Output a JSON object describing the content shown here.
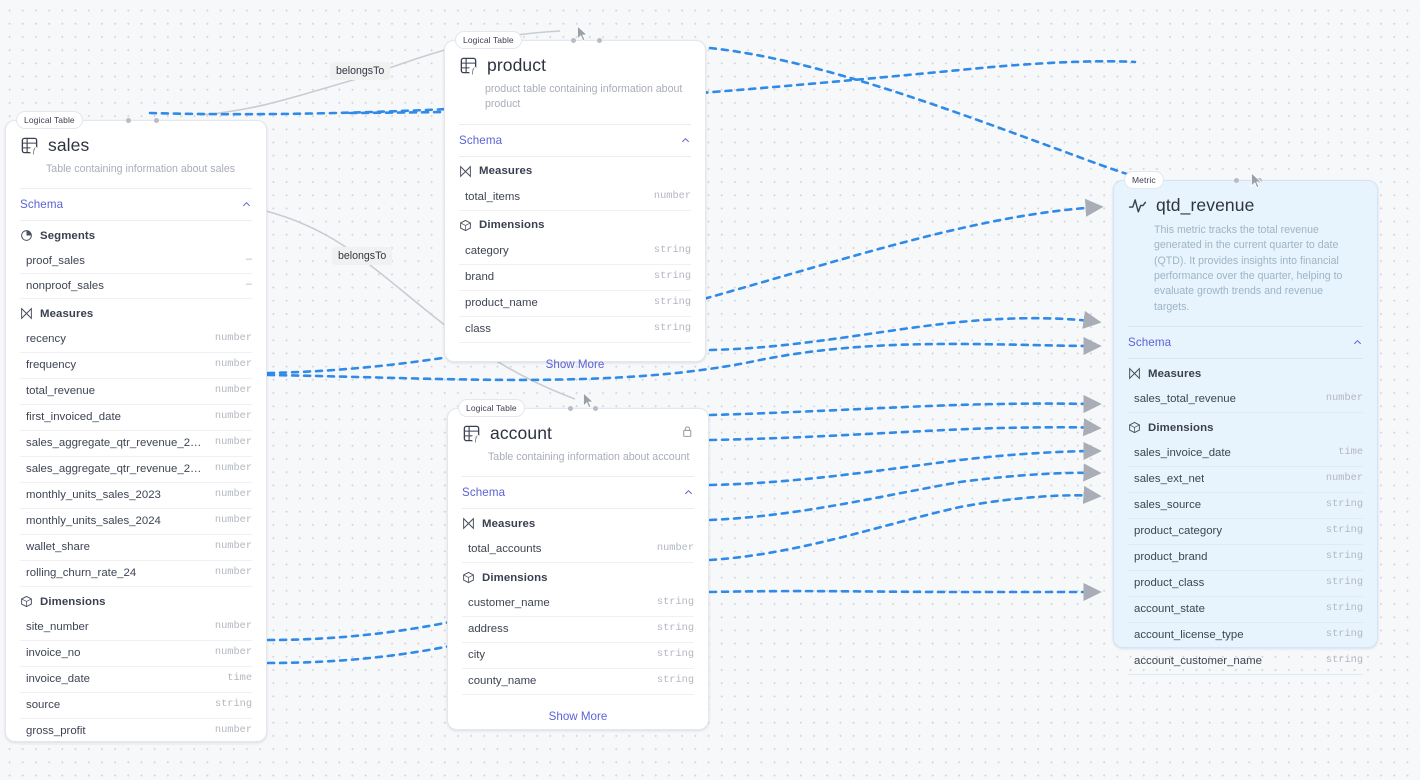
{
  "canvas": {
    "background_color": "#f7f8fa",
    "grid_dot_color": "#d2d6dd",
    "edge_color_primary": "#2f8ae8",
    "edge_color_secondary": "#c9ccd2",
    "accent_color": "#5b62d6",
    "metric_card_color": "#e8f4fd"
  },
  "edge_labels": [
    {
      "text": "belongsTo"
    },
    {
      "text": "belongsTo"
    }
  ],
  "nodes": {
    "sales": {
      "badge": "Logical Table",
      "title": "sales",
      "description": "Table containing information about sales",
      "icon": "table-function-icon",
      "schema_label": "Schema",
      "groups": [
        {
          "name": "Segments",
          "icon": "segments-icon",
          "fields": [
            {
              "name": "proof_sales",
              "type": "–"
            },
            {
              "name": "nonproof_sales",
              "type": "–"
            }
          ]
        },
        {
          "name": "Measures",
          "icon": "measures-icon",
          "fields": [
            {
              "name": "recency",
              "type": "number"
            },
            {
              "name": "frequency",
              "type": "number"
            },
            {
              "name": "total_revenue",
              "type": "number"
            },
            {
              "name": "first_invoiced_date",
              "type": "number"
            },
            {
              "name": "sales_aggregate_qtr_revenue_20...",
              "type": "number"
            },
            {
              "name": "sales_aggregate_qtr_revenue_20...",
              "type": "number"
            },
            {
              "name": "monthly_units_sales_2023",
              "type": "number"
            },
            {
              "name": "monthly_units_sales_2024",
              "type": "number"
            },
            {
              "name": "wallet_share",
              "type": "number"
            },
            {
              "name": "rolling_churn_rate_24",
              "type": "number"
            }
          ]
        },
        {
          "name": "Dimensions",
          "icon": "dimensions-icon",
          "fields": [
            {
              "name": "site_number",
              "type": "number"
            },
            {
              "name": "invoice_no",
              "type": "number"
            },
            {
              "name": "invoice_date",
              "type": "time"
            },
            {
              "name": "source",
              "type": "string"
            },
            {
              "name": "gross_profit",
              "type": "number"
            }
          ]
        }
      ]
    },
    "product": {
      "badge": "Logical Table",
      "title": "product",
      "description": "product table containing information about product",
      "icon": "table-function-icon",
      "schema_label": "Schema",
      "show_more": "Show More",
      "groups": [
        {
          "name": "Measures",
          "icon": "measures-icon",
          "fields": [
            {
              "name": "total_items",
              "type": "number"
            }
          ]
        },
        {
          "name": "Dimensions",
          "icon": "dimensions-icon",
          "fields": [
            {
              "name": "category",
              "type": "string"
            },
            {
              "name": "brand",
              "type": "string"
            },
            {
              "name": "product_name",
              "type": "string"
            },
            {
              "name": "class",
              "type": "string"
            }
          ]
        }
      ]
    },
    "account": {
      "badge": "Logical Table",
      "title": "account",
      "description": "Table containing information about account",
      "icon": "table-function-icon",
      "lock_icon": "lock-icon",
      "schema_label": "Schema",
      "show_more": "Show More",
      "groups": [
        {
          "name": "Measures",
          "icon": "measures-icon",
          "fields": [
            {
              "name": "total_accounts",
              "type": "number"
            }
          ]
        },
        {
          "name": "Dimensions",
          "icon": "dimensions-icon",
          "fields": [
            {
              "name": "customer_name",
              "type": "string"
            },
            {
              "name": "address",
              "type": "string"
            },
            {
              "name": "city",
              "type": "string"
            },
            {
              "name": "county_name",
              "type": "string"
            }
          ]
        }
      ]
    },
    "qtd_revenue": {
      "badge": "Metric",
      "title": "qtd_revenue",
      "description": "This metric tracks the total revenue generated in the current quarter to date (QTD). It provides insights into financial performance over the quarter, helping to evaluate growth trends and revenue targets.",
      "icon": "activity-pulse-icon",
      "schema_label": "Schema",
      "groups": [
        {
          "name": "Measures",
          "icon": "measures-icon",
          "fields": [
            {
              "name": "sales_total_revenue",
              "type": "number"
            }
          ]
        },
        {
          "name": "Dimensions",
          "icon": "dimensions-icon",
          "fields": [
            {
              "name": "sales_invoice_date",
              "type": "time"
            },
            {
              "name": "sales_ext_net",
              "type": "number"
            },
            {
              "name": "sales_source",
              "type": "string"
            },
            {
              "name": "product_category",
              "type": "string"
            },
            {
              "name": "product_brand",
              "type": "string"
            },
            {
              "name": "product_class",
              "type": "string"
            },
            {
              "name": "account_state",
              "type": "string"
            },
            {
              "name": "account_license_type",
              "type": "string"
            },
            {
              "name": "account_customer_name",
              "type": "string"
            }
          ]
        }
      ]
    }
  }
}
